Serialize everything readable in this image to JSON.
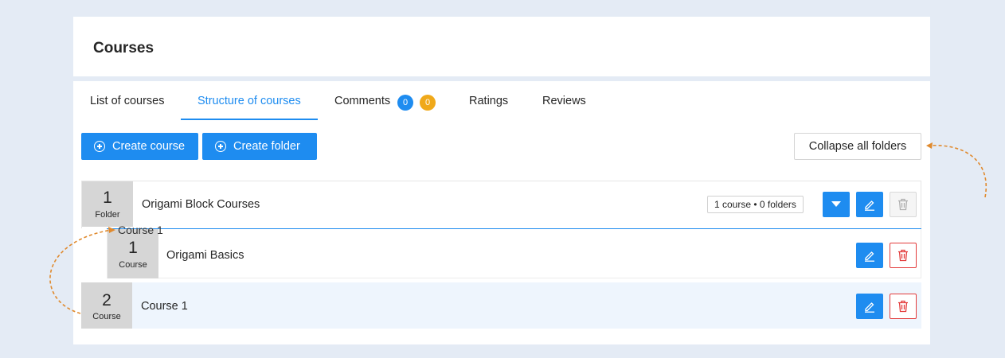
{
  "page": {
    "title": "Courses"
  },
  "tabs": [
    {
      "label": "List of courses",
      "active": false
    },
    {
      "label": "Structure of courses",
      "active": true
    },
    {
      "label": "Comments",
      "active": false,
      "badges": [
        {
          "value": "0",
          "color": "#1e8cf0"
        },
        {
          "value": "0",
          "color": "#f0a91a"
        }
      ]
    },
    {
      "label": "Ratings",
      "active": false
    },
    {
      "label": "Reviews",
      "active": false
    }
  ],
  "toolbar": {
    "create_course": "Create course",
    "create_folder": "Create folder",
    "collapse_all": "Collapse all folders"
  },
  "structure": {
    "folder": {
      "number": "1",
      "type": "Folder",
      "title": "Origami Block Courses",
      "summary": "1 course • 0 folders",
      "children": [
        {
          "number": "1",
          "type": "Course",
          "title": "Origami Basics"
        }
      ]
    },
    "course": {
      "number": "2",
      "type": "Course",
      "title": "Course 1"
    },
    "drag_ghost_label": "Course 1"
  },
  "colors": {
    "accent": "#1e8cf0",
    "warning_badge": "#f0a91a",
    "danger": "#e33b3b",
    "annotation_arrow": "#e08a2e",
    "background": "#e4ebf5"
  },
  "icons": {
    "create": "plus-circle-icon",
    "expand": "caret-down-icon",
    "edit": "pencil-icon",
    "delete": "trash-icon"
  }
}
